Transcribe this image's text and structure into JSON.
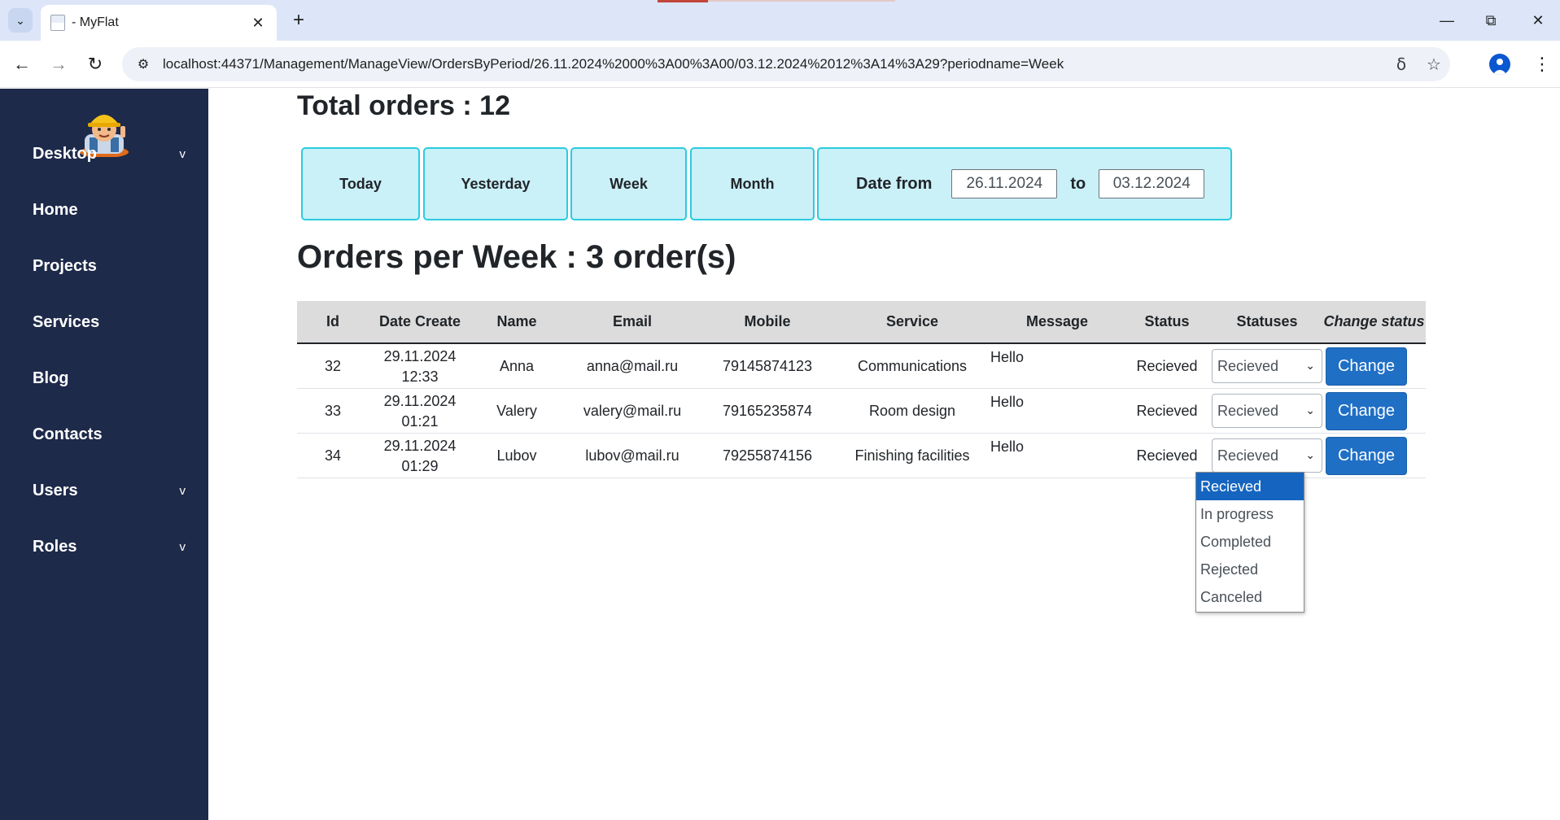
{
  "browser": {
    "tab_title": "- MyFlat",
    "url": "localhost:44371/Management/ManageView/OrdersByPeriod/26.11.2024%2000%3A00%3A00/03.12.2024%2012%3A14%3A29?periodname=Week"
  },
  "sidebar": {
    "items": [
      {
        "label": "Desktop",
        "caret": "v"
      },
      {
        "label": "Home"
      },
      {
        "label": "Projects"
      },
      {
        "label": "Services"
      },
      {
        "label": "Blog"
      },
      {
        "label": "Contacts"
      },
      {
        "label": "Users",
        "caret": "v"
      },
      {
        "label": "Roles",
        "caret": "v"
      }
    ]
  },
  "main": {
    "total_orders": "Total orders : 12",
    "periods": [
      "Today",
      "Yesterday",
      "Week",
      "Month"
    ],
    "date_from_label": "Date from",
    "date_from": "26.11.2024",
    "to_label": "to",
    "date_to": "03.12.2024",
    "orders_title": "Orders per Week : 3 order(s)"
  },
  "table": {
    "headers": [
      "Id",
      "Date Create",
      "Name",
      "Email",
      "Mobile",
      "Service",
      "Message",
      "Status",
      "Statuses",
      "Change status"
    ],
    "rows": [
      {
        "id": "32",
        "date": "29.11.2024",
        "time": "12:33",
        "name": "Anna",
        "email": "anna@mail.ru",
        "mobile": "79145874123",
        "service": "Communications",
        "message": "Hello",
        "status": "Recieved",
        "select": "Recieved",
        "button": "Change"
      },
      {
        "id": "33",
        "date": "29.11.2024",
        "time": "01:21",
        "name": "Valery",
        "email": "valery@mail.ru",
        "mobile": "79165235874",
        "service": "Room design",
        "message": "Hello",
        "status": "Recieved",
        "select": "Recieved",
        "button": "Change"
      },
      {
        "id": "34",
        "date": "29.11.2024",
        "time": "01:29",
        "name": "Lubov",
        "email": "lubov@mail.ru",
        "mobile": "79255874156",
        "service": "Finishing facilities",
        "message": "Hello",
        "status": "Recieved",
        "select": "Recieved",
        "button": "Change"
      }
    ]
  },
  "dropdown": {
    "options": [
      "Recieved",
      "In progress",
      "Completed",
      "Rejected",
      "Canceled"
    ],
    "selected": "Recieved"
  },
  "colors": {
    "sidebar": "#1e2a4a",
    "period_bg": "#caf0f8",
    "period_border": "#2ccbe0",
    "button": "#1f6fc5",
    "dropdown_selected": "#1565c0"
  }
}
